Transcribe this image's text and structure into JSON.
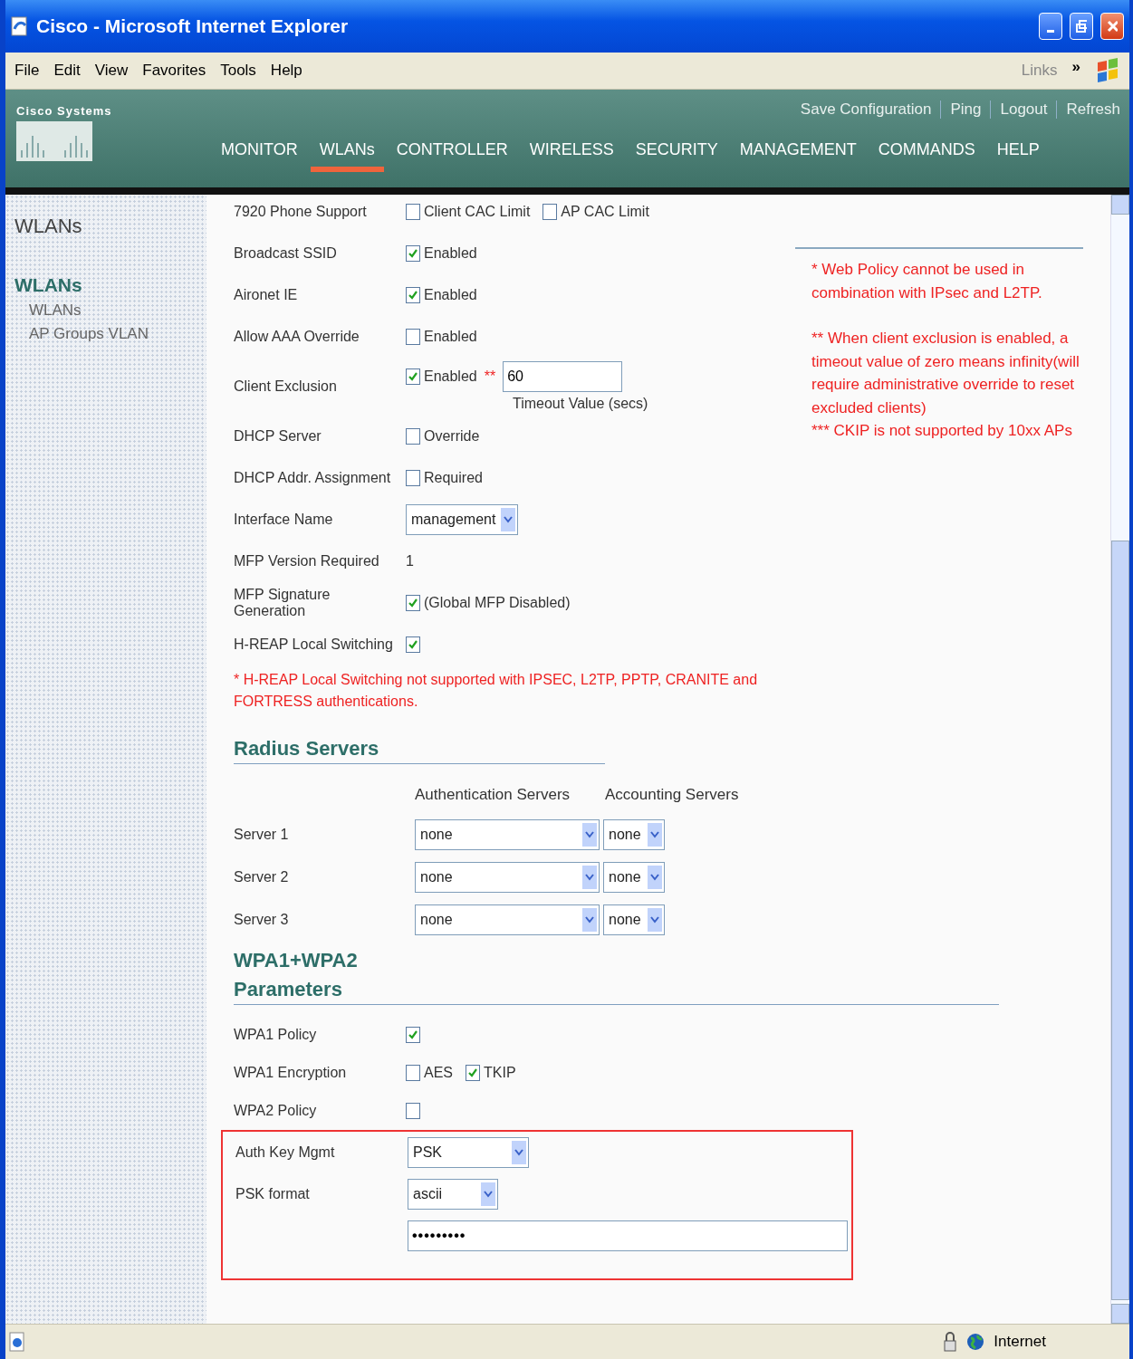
{
  "window": {
    "title": "Cisco - Microsoft Internet Explorer"
  },
  "menu": [
    "File",
    "Edit",
    "View",
    "Favorites",
    "Tools",
    "Help"
  ],
  "links_label": "Links",
  "links_chevron": "»",
  "header": {
    "logo": "Cisco Systems",
    "actions": [
      "Save Configuration",
      "Ping",
      "Logout",
      "Refresh"
    ],
    "tabs": [
      {
        "label": "MONITOR",
        "selected": false
      },
      {
        "label": "WLANs",
        "selected": true
      },
      {
        "label": "CONTROLLER",
        "selected": false
      },
      {
        "label": "WIRELESS",
        "selected": false
      },
      {
        "label": "SECURITY",
        "selected": false
      },
      {
        "label": "MANAGEMENT",
        "selected": false
      },
      {
        "label": "COMMANDS",
        "selected": false
      },
      {
        "label": "HELP",
        "selected": false
      }
    ]
  },
  "sidebar": {
    "title": "WLANs",
    "section": "WLANs",
    "items": [
      "WLANs",
      "AP Groups VLAN"
    ]
  },
  "rows": [
    {
      "kind": "checks",
      "label": "7920 Phone Support",
      "checks": [
        {
          "label": "Client CAC Limit",
          "checked": false
        },
        {
          "label": "AP CAC Limit",
          "checked": false
        }
      ]
    },
    {
      "kind": "checks",
      "label": "Broadcast SSID",
      "checks": [
        {
          "label": "Enabled",
          "checked": true
        }
      ]
    },
    {
      "kind": "checks",
      "label": "Aironet IE",
      "checks": [
        {
          "label": "Enabled",
          "checked": true
        }
      ]
    },
    {
      "kind": "checks",
      "label": "Allow AAA Override",
      "checks": [
        {
          "label": "Enabled",
          "checked": false
        }
      ]
    },
    {
      "kind": "exclusion",
      "label": "Client Exclusion",
      "checks": [
        {
          "label": "Enabled",
          "checked": true
        }
      ],
      "mark": "**",
      "value": "60",
      "hint": "Timeout Value (secs)"
    },
    {
      "kind": "checks",
      "label": "DHCP Server",
      "checks": [
        {
          "label": "Override",
          "checked": false
        }
      ]
    },
    {
      "kind": "checks",
      "label": "DHCP Addr. Assignment",
      "checks": [
        {
          "label": "Required",
          "checked": false
        }
      ]
    },
    {
      "kind": "select",
      "label": "Interface Name",
      "value": "management"
    },
    {
      "kind": "text",
      "label": "MFP Version Required",
      "value": "1"
    },
    {
      "kind": "checks",
      "label": "MFP Signature Generation",
      "checks": [
        {
          "label": "(Global MFP Disabled)",
          "checked": true
        }
      ]
    },
    {
      "kind": "checks",
      "label": "H-REAP Local Switching",
      "checks": [
        {
          "checked": true
        }
      ]
    }
  ],
  "hreap_note": "* H-REAP Local Switching not supported with IPSEC, L2TP, PPTP, CRANITE and FORTRESS authentications.",
  "notes": [
    "* Web Policy cannot be used in combination with IPsec and L2TP.",
    "** When client exclusion is enabled, a timeout value of zero means infinity(will require administrative override to reset excluded clients)",
    "*** CKIP is not supported by 10xx APs"
  ],
  "radius": {
    "title": "Radius Servers",
    "columns": [
      "Authentication Servers",
      "Accounting Servers"
    ],
    "servers": [
      {
        "label": "Server 1",
        "auth": "none",
        "acct": "none"
      },
      {
        "label": "Server 2",
        "auth": "none",
        "acct": "none"
      },
      {
        "label": "Server 3",
        "auth": "none",
        "acct": "none"
      }
    ]
  },
  "wpa": {
    "title": "WPA1+WPA2 Parameters",
    "rows": [
      {
        "kind": "checks",
        "label": "WPA1 Policy",
        "checks": [
          {
            "checked": true
          }
        ]
      },
      {
        "kind": "checks",
        "label": "WPA1 Encryption",
        "checks": [
          {
            "label": "AES",
            "checked": false
          },
          {
            "label": "TKIP",
            "checked": true
          }
        ]
      },
      {
        "kind": "checks",
        "label": "WPA2 Policy",
        "checks": [
          {
            "checked": false
          }
        ]
      }
    ],
    "highlighted": [
      {
        "kind": "select",
        "label": "Auth Key Mgmt",
        "value": "PSK"
      },
      {
        "kind": "select",
        "label": "PSK format",
        "value": "ascii"
      },
      {
        "kind": "password",
        "value": "•••••••••"
      }
    ]
  },
  "status_bar": {
    "zone": "Internet"
  }
}
